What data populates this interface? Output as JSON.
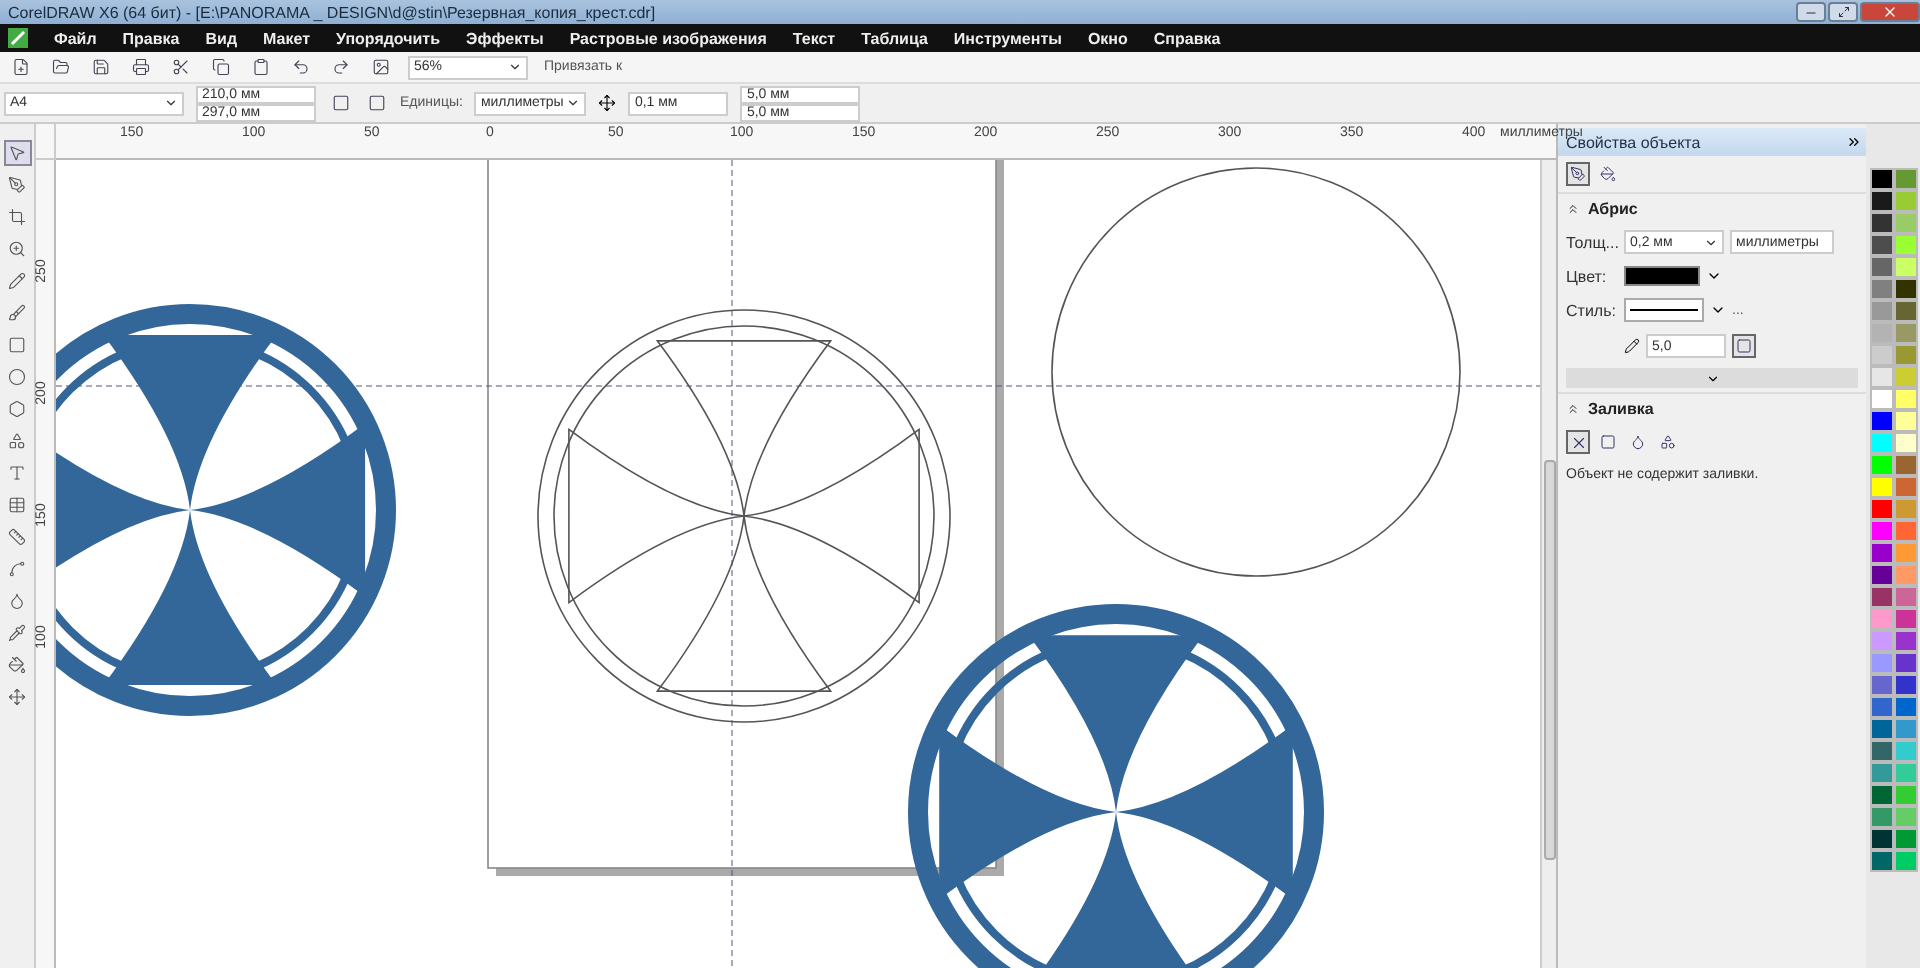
{
  "window": {
    "title": "CorelDRAW X6 (64 бит) - [E:\\PANORAMA _ DESIGN\\d@stin\\Резервная_копия_крест.cdr]"
  },
  "menu": [
    "Файл",
    "Правка",
    "Вид",
    "Макет",
    "Упорядочить",
    "Эффекты",
    "Растровые изображения",
    "Текст",
    "Таблица",
    "Инструменты",
    "Окно",
    "Справка"
  ],
  "toolbar": {
    "zoom": "56%",
    "snap": "Привязать к"
  },
  "property_bar": {
    "page_size": "A4",
    "width": "210,0 мм",
    "height": "297,0 мм",
    "units_label": "Единицы:",
    "units": "миллиметры",
    "nudge": "0,1 мм",
    "dup_x": "5,0 мм",
    "dup_y": "5,0 мм"
  },
  "h_ruler": {
    "labels": [
      "150",
      "100",
      "50",
      "0",
      "50",
      "100",
      "150",
      "200",
      "250",
      "300",
      "350",
      "400"
    ],
    "unit": "миллиметры"
  },
  "v_ruler": {
    "labels": [
      "250",
      "200",
      "150",
      "100"
    ]
  },
  "docker": {
    "title": "Свойства объекта",
    "outline": {
      "title": "Абрис",
      "width_label": "Толщ...",
      "width": "0,2 мм",
      "units": "миллиметры",
      "color_label": "Цвет:",
      "style_label": "Стиль:",
      "more": "...",
      "miter": "5,0"
    },
    "fill": {
      "title": "Заливка",
      "message": "Объект не содержит заливки."
    }
  },
  "palette": [
    {
      "color": "#000000"
    },
    {
      "color": "#1a1a1a"
    },
    {
      "color": "#333333"
    },
    {
      "color": "#4d4d4d"
    },
    {
      "color": "#666666"
    },
    {
      "color": "#808080"
    },
    {
      "color": "#999999"
    },
    {
      "color": "#b3b3b3"
    },
    {
      "color": "#cccccc"
    },
    {
      "color": "#e6e6e6"
    },
    {
      "color": "#ffffff"
    },
    {
      "color": "#0000ff"
    },
    {
      "color": "#00ffff"
    },
    {
      "color": "#00ff00"
    },
    {
      "color": "#ffff00"
    },
    {
      "color": "#ff0000"
    },
    {
      "color": "#ff00ff"
    },
    {
      "color": "#9900cc"
    },
    {
      "color": "#660099"
    },
    {
      "color": "#993366"
    },
    {
      "color": "#ff99cc"
    },
    {
      "color": "#cc99ff"
    },
    {
      "color": "#9999ff"
    },
    {
      "color": "#6666cc"
    },
    {
      "color": "#3366cc"
    },
    {
      "color": "#006699"
    },
    {
      "color": "#336666"
    },
    {
      "color": "#339999"
    },
    {
      "color": "#006633"
    },
    {
      "color": "#339966"
    },
    {
      "color": "#003333"
    },
    {
      "color": "#006666"
    },
    {
      "color": "#669933"
    },
    {
      "color": "#99cc33"
    },
    {
      "color": "#99cc66"
    },
    {
      "color": "#99ff33"
    },
    {
      "color": "#ccff66"
    },
    {
      "color": "#333300"
    },
    {
      "color": "#666633"
    },
    {
      "color": "#999966"
    },
    {
      "color": "#999933"
    },
    {
      "color": "#cccc33"
    },
    {
      "color": "#ffff66"
    },
    {
      "color": "#ffff99"
    },
    {
      "color": "#ffffcc"
    },
    {
      "color": "#996633"
    },
    {
      "color": "#cc6633"
    },
    {
      "color": "#cc9933"
    },
    {
      "color": "#ff6633"
    },
    {
      "color": "#ff9933"
    },
    {
      "color": "#ff9966"
    },
    {
      "color": "#cc6699"
    },
    {
      "color": "#cc3399"
    },
    {
      "color": "#9933cc"
    },
    {
      "color": "#6633cc"
    },
    {
      "color": "#3333cc"
    },
    {
      "color": "#0066cc"
    },
    {
      "color": "#3399cc"
    },
    {
      "color": "#33cccc"
    },
    {
      "color": "#33cc99"
    },
    {
      "color": "#33cc33"
    },
    {
      "color": "#66cc66"
    },
    {
      "color": "#009933"
    },
    {
      "color": "#00cc66"
    }
  ]
}
